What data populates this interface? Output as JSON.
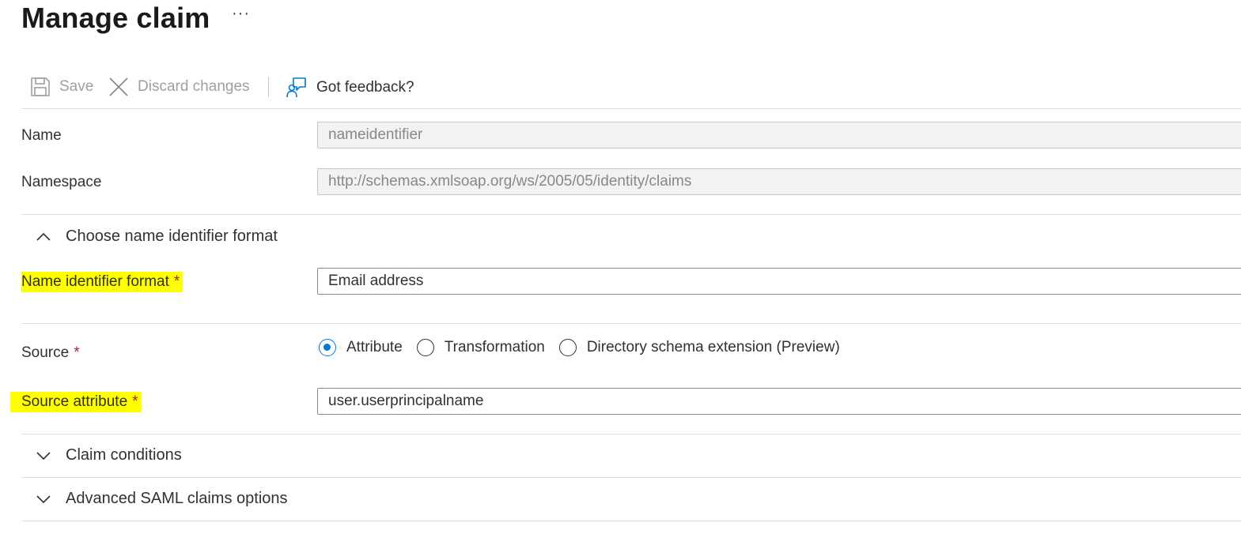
{
  "page": {
    "title": "Manage claim",
    "more_label": "···"
  },
  "toolbar": {
    "save_label": "Save",
    "discard_label": "Discard changes",
    "feedback_label": "Got feedback?"
  },
  "fields": {
    "name": {
      "label": "Name",
      "value": "nameidentifier"
    },
    "namespace": {
      "label": "Namespace",
      "value": "http://schemas.xmlsoap.org/ws/2005/05/identity/claims"
    }
  },
  "sections": {
    "name_id_format": {
      "label": "Choose name identifier format",
      "expanded": true
    },
    "claim_conditions": {
      "label": "Claim conditions",
      "expanded": false
    },
    "advanced_saml": {
      "label": "Advanced SAML claims options",
      "expanded": false
    }
  },
  "name_id_format": {
    "label": "Name identifier format",
    "required_mark": "*",
    "value": "Email address"
  },
  "source": {
    "label": "Source",
    "required_mark": "*",
    "options": [
      {
        "label": "Attribute",
        "checked": true
      },
      {
        "label": "Transformation",
        "checked": false
      },
      {
        "label": "Directory schema extension (Preview)",
        "checked": false
      }
    ]
  },
  "source_attribute": {
    "label": "Source attribute",
    "required_mark": "*",
    "value": "user.userprincipalname"
  },
  "colors": {
    "accent": "#0078d4",
    "highlight": "#ffff00",
    "required": "#a4262c"
  }
}
